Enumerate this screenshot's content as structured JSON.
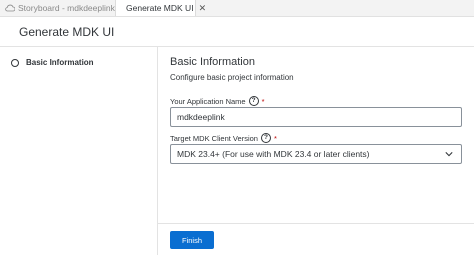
{
  "tabs": [
    {
      "label": "Storyboard - mdkdeeplink",
      "icon": "cloud-icon",
      "active": false
    },
    {
      "label": "Generate MDK UI",
      "icon": "close-icon",
      "active": true
    }
  ],
  "page": {
    "title": "Generate MDK UI"
  },
  "steps": [
    {
      "label": "Basic Information",
      "icon": "step-circle-icon"
    }
  ],
  "section": {
    "title": "Basic Information",
    "description": "Configure basic project information"
  },
  "fields": {
    "app_name": {
      "label": "Your Application Name",
      "required_mark": "*",
      "help_icon": "?",
      "value": "mdkdeeplink"
    },
    "mdk_version": {
      "label": "Target MDK Client Version",
      "required_mark": "*",
      "help_icon": "?",
      "selected": "MDK 23.4+ (For use with MDK 23.4 or later clients)"
    }
  },
  "footer": {
    "finish_label": "Finish"
  },
  "colors": {
    "accent": "#0a6ed1",
    "required": "#bb0000",
    "text": "#32363a"
  }
}
